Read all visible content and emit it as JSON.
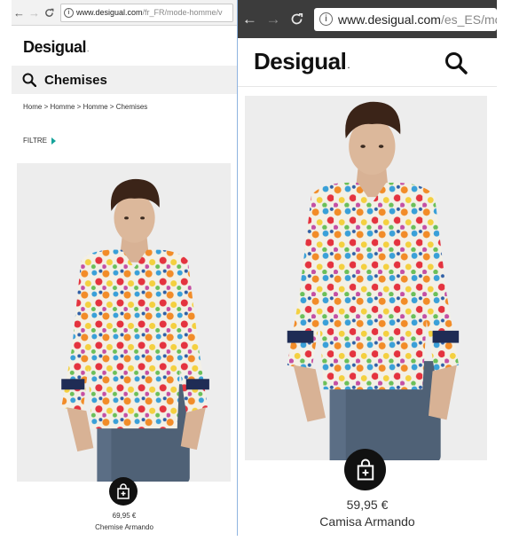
{
  "left": {
    "url": {
      "host": "www.desigual.com",
      "path": "/fr_FR/mode-homme/v"
    },
    "logo": "Desigual",
    "logo_mark": ".",
    "category_title": "Chemises",
    "breadcrumb": "Home > Homme > Homme > Chemises",
    "filter_label": "FILTRE",
    "product": {
      "price": "69,95 €",
      "name": "Chemise Armando"
    }
  },
  "right": {
    "url": {
      "host": "www.desigual.com",
      "path": "/es_ES/mod"
    },
    "logo": "Desigual",
    "logo_mark": ".",
    "product": {
      "price": "59,95 €",
      "name": "Camisa Armando"
    }
  },
  "browser": {
    "back": "←",
    "forward": "→",
    "reload": "C",
    "info": "i"
  },
  "colors": {
    "accent_teal": "#14a39a",
    "bag_button": "#111111",
    "dark_toolbar": "#3c3c3c"
  }
}
